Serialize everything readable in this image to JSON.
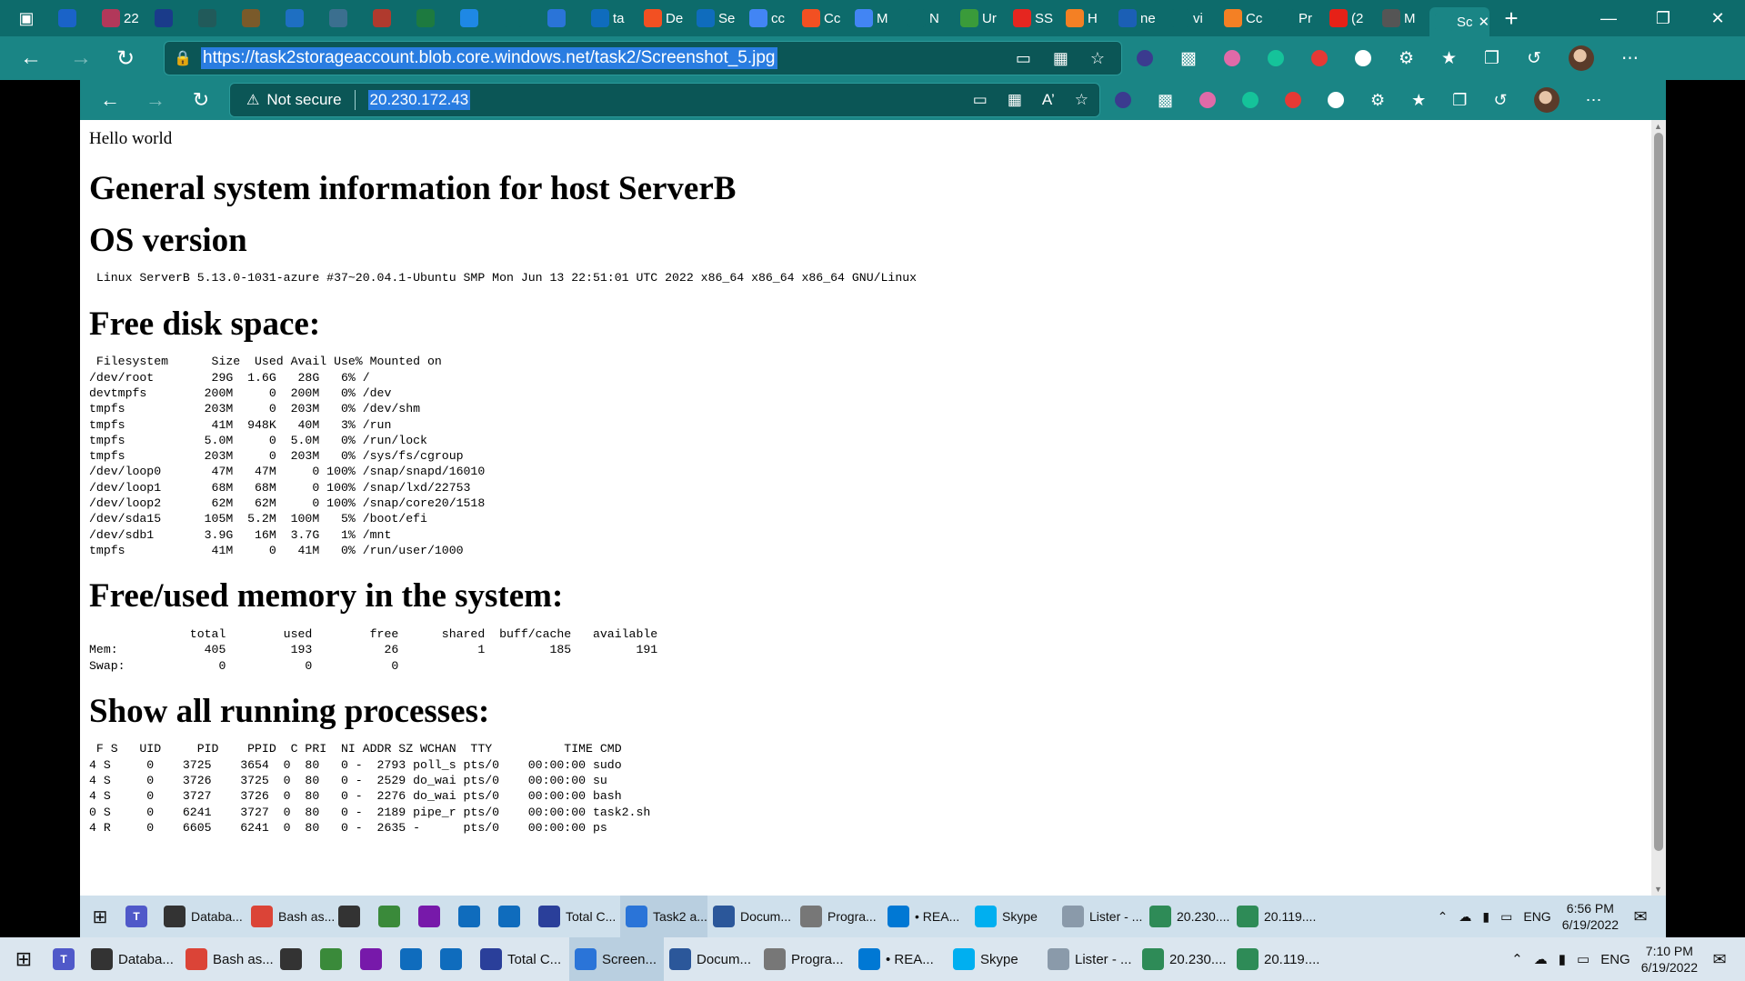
{
  "outer_browser": {
    "tabs": [
      {
        "label": "",
        "icon": "outlook-icon",
        "color": "#1a63c8"
      },
      {
        "label": "22",
        "icon": "badge-icon",
        "color": "#b2385a"
      },
      {
        "label": "",
        "icon": "circle-app-icon",
        "color": "#1a3b8a"
      },
      {
        "label": "",
        "icon": "dark-app-icon",
        "color": "#215a5a"
      },
      {
        "label": "",
        "icon": "film-icon",
        "color": "#7a5a2a"
      },
      {
        "label": "",
        "icon": "ef-icon",
        "color": "#1e6fc2"
      },
      {
        "label": "",
        "icon": "x-app-icon",
        "color": "#3b6f8f"
      },
      {
        "label": "",
        "icon": "red-app-icon",
        "color": "#b03a2e"
      },
      {
        "label": "",
        "icon": "excel-icon",
        "color": "#1d7a3f"
      },
      {
        "label": "",
        "icon": "cloud-icon",
        "color": "#1e88e5"
      },
      {
        "label": "",
        "icon": "blank-icon",
        "color": "#0d6b6b"
      },
      {
        "label": "",
        "icon": "edge-icon",
        "color": "#2a74d8"
      },
      {
        "label": "ta",
        "icon": "azure-icon",
        "color": "#0f6cbd"
      },
      {
        "label": "De",
        "icon": "microsoft-icon",
        "color": "#f25022"
      },
      {
        "label": "Se",
        "icon": "azure-icon",
        "color": "#0f6cbd"
      },
      {
        "label": "cc",
        "icon": "google-icon",
        "color": "#4285f4"
      },
      {
        "label": "Cc",
        "icon": "microsoft-icon",
        "color": "#f25022"
      },
      {
        "label": "M",
        "icon": "google-icon",
        "color": "#4285f4"
      },
      {
        "label": "N",
        "icon": "ampersand-icon",
        "color": "#0d6b6b"
      },
      {
        "label": "Ur",
        "icon": "cube-icon",
        "color": "#3a9b3a"
      },
      {
        "label": "SS",
        "icon": "yandex-icon",
        "color": "#e52620"
      },
      {
        "label": "H",
        "icon": "stackoverflow-icon",
        "color": "#f48024"
      },
      {
        "label": "ne",
        "icon": "brace-icon",
        "color": "#1b5fb5"
      },
      {
        "label": "vi",
        "icon": "ampersand-icon",
        "color": "#0d6b6b"
      },
      {
        "label": "Cc",
        "icon": "stackoverflow-icon",
        "color": "#f48024"
      },
      {
        "label": "Pr",
        "icon": "page-icon",
        "color": "#0d6b6b"
      },
      {
        "label": "(2",
        "icon": "youtube-icon",
        "color": "#e62117"
      },
      {
        "label": "M",
        "icon": "md-icon",
        "color": "#555555"
      },
      {
        "label": "Sc",
        "icon": "screenshot-icon",
        "color": "#1a8585",
        "active": true
      }
    ],
    "url": "https://task2storageaccount.blob.core.windows.net/task2/Screenshot_5.jpg"
  },
  "inner_browser": {
    "security": "Not secure",
    "url": "20.230.172.43"
  },
  "page": {
    "hello": "Hello world",
    "title": "General system information for host ServerB",
    "os_heading": "OS version",
    "os_text": " Linux ServerB 5.13.0-1031-azure #37~20.04.1-Ubuntu SMP Mon Jun 13 22:51:01 UTC 2022 x86_64 x86_64 x86_64 GNU/Linux",
    "disk_heading": "Free disk space:",
    "disk_text": " Filesystem      Size  Used Avail Use% Mounted on\n/dev/root        29G  1.6G   28G   6% /\ndevtmpfs        200M     0  200M   0% /dev\ntmpfs           203M     0  203M   0% /dev/shm\ntmpfs            41M  948K   40M   3% /run\ntmpfs           5.0M     0  5.0M   0% /run/lock\ntmpfs           203M     0  203M   0% /sys/fs/cgroup\n/dev/loop0       47M   47M     0 100% /snap/snapd/16010\n/dev/loop1       68M   68M     0 100% /snap/lxd/22753\n/dev/loop2       62M   62M     0 100% /snap/core20/1518\n/dev/sda15      105M  5.2M  100M   5% /boot/efi\n/dev/sdb1       3.9G   16M  3.7G   1% /mnt\ntmpfs            41M     0   41M   0% /run/user/1000",
    "mem_heading": "Free/used memory in the system:",
    "mem_text": "              total        used        free      shared  buff/cache   available\nMem:            405         193          26           1         185         191\nSwap:             0           0           0",
    "proc_heading": "Show all running processes:",
    "proc_text": " F S   UID     PID    PPID  C PRI  NI ADDR SZ WCHAN  TTY          TIME CMD\n4 S     0    3725    3654  0  80   0 -  2793 poll_s pts/0    00:00:00 sudo\n4 S     0    3726    3725  0  80   0 -  2529 do_wai pts/0    00:00:00 su\n4 S     0    3727    3726  0  80   0 -  2276 do_wai pts/0    00:00:00 bash\n0 S     0    6241    3727  0  80   0 -  2189 pipe_r pts/0    00:00:00 task2.sh\n4 R     0    6605    6241  0  80   0 -  2635 -      pts/0    00:00:00 ps"
  },
  "inner_taskbar": {
    "items": [
      {
        "label": "Databa...",
        "icon": "lock-app-icon",
        "color": "#333333"
      },
      {
        "label": "Bash as...",
        "icon": "chrome-icon",
        "color": "#db4437"
      },
      {
        "label": "",
        "icon": "terminal-icon",
        "color": "#333333"
      },
      {
        "label": "",
        "icon": "image-app-icon",
        "color": "#3a8a3a"
      },
      {
        "label": "",
        "icon": "onenote-icon",
        "color": "#7719aa"
      },
      {
        "label": "",
        "icon": "outlook-icon",
        "color": "#0f6cbd"
      },
      {
        "label": "",
        "icon": "remote-icon",
        "color": "#0f6cbd"
      },
      {
        "label": "Total C...",
        "icon": "floppy-icon",
        "color": "#2a3f9a"
      },
      {
        "label": "Task2 a...",
        "icon": "edge-icon",
        "color": "#2a74d8",
        "active": true
      },
      {
        "label": "Docum...",
        "icon": "word-icon",
        "color": "#2b579a"
      },
      {
        "label": "Progra...",
        "icon": "program-icon",
        "color": "#777777"
      },
      {
        "label": "• REA...",
        "icon": "vscode-icon",
        "color": "#0078d4"
      },
      {
        "label": "Skype",
        "icon": "skype-icon",
        "color": "#00aff0"
      },
      {
        "label": "Lister - ...",
        "icon": "lister-icon",
        "color": "#8a9aaa"
      },
      {
        "label": "20.230....",
        "icon": "terminal-t-icon",
        "color": "#2e8b57"
      },
      {
        "label": "20.119....",
        "icon": "terminal-t-icon",
        "color": "#2e8b57"
      }
    ],
    "lang": "ENG",
    "time": "6:56 PM",
    "date": "6/19/2022"
  },
  "outer_taskbar": {
    "items": [
      {
        "label": "Databa...",
        "icon": "lock-app-icon",
        "color": "#333333"
      },
      {
        "label": "Bash as...",
        "icon": "chrome-icon",
        "color": "#db4437"
      },
      {
        "label": "",
        "icon": "terminal-icon",
        "color": "#333333"
      },
      {
        "label": "",
        "icon": "image-app-icon",
        "color": "#3a8a3a"
      },
      {
        "label": "",
        "icon": "onenote-icon",
        "color": "#7719aa"
      },
      {
        "label": "",
        "icon": "outlook-icon",
        "color": "#0f6cbd"
      },
      {
        "label": "",
        "icon": "remote-icon",
        "color": "#0f6cbd"
      },
      {
        "label": "Total C...",
        "icon": "floppy-icon",
        "color": "#2a3f9a"
      },
      {
        "label": "Screen...",
        "icon": "edge-icon",
        "color": "#2a74d8",
        "active": true
      },
      {
        "label": "Docum...",
        "icon": "word-icon",
        "color": "#2b579a"
      },
      {
        "label": "Progra...",
        "icon": "program-icon",
        "color": "#777777"
      },
      {
        "label": "• REA...",
        "icon": "vscode-icon",
        "color": "#0078d4"
      },
      {
        "label": "Skype",
        "icon": "skype-icon",
        "color": "#00aff0"
      },
      {
        "label": "Lister - ...",
        "icon": "lister-icon",
        "color": "#8a9aaa"
      },
      {
        "label": "20.230....",
        "icon": "terminal-t-icon",
        "color": "#2e8b57"
      },
      {
        "label": "20.119....",
        "icon": "terminal-t-icon",
        "color": "#2e8b57"
      }
    ],
    "lang": "ENG",
    "time": "7:10 PM",
    "date": "6/19/2022"
  }
}
